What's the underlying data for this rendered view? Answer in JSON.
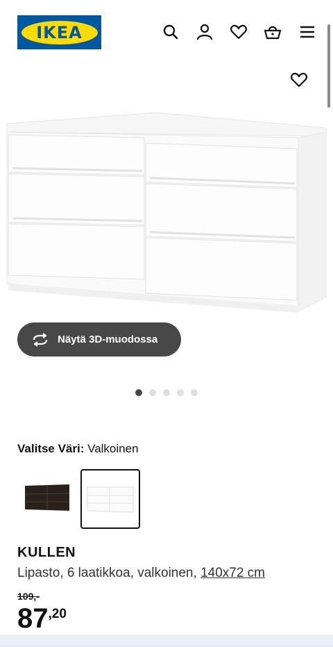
{
  "header": {
    "logo_text": "IKEA",
    "icons": [
      "search-icon",
      "user-icon",
      "heart-icon",
      "basket-icon",
      "menu-icon"
    ]
  },
  "product_gallery": {
    "favorite_icon": "heart-icon",
    "view_3d_label": "Näytä 3D-muodossa",
    "image_count": 5,
    "active_image": 1
  },
  "color_picker": {
    "label": "Valitse Väri:",
    "selected_value": "Valkoinen",
    "options": [
      "dark-brown",
      "white"
    ],
    "selected_index": 1
  },
  "product": {
    "name": "KULLEN",
    "description": "Lipasto, 6 laatikkoa, valkoinen,",
    "size_link": "140x72 cm",
    "old_price": "109,-",
    "price_integer": "87",
    "price_decimal": ",20"
  },
  "colors": {
    "logo_blue": "#0058a3",
    "logo_yellow": "#ffdb00",
    "button_bg": "#484848"
  }
}
